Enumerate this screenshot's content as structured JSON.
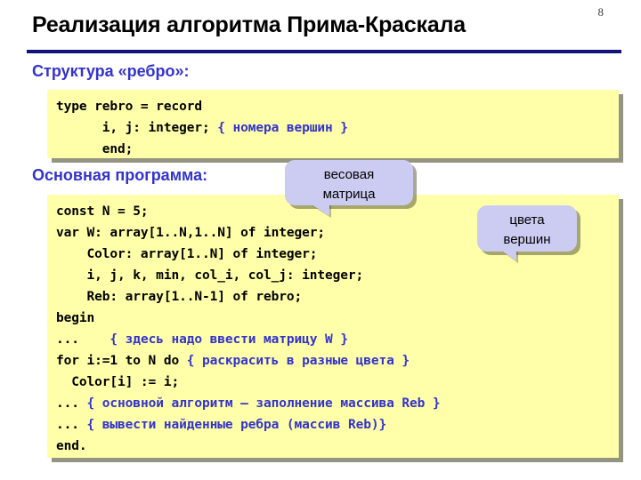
{
  "slide": {
    "number": "8",
    "title": "Реализация алгоритма Прима-Краскала",
    "accent_color": "#12127a",
    "heading_color": "#3333cc",
    "code_background": "#ffffaa",
    "callout_background": "#ccccf2"
  },
  "sections": {
    "structure_heading": "Структура «ребро»:",
    "main_program_heading": "Основная программа:"
  },
  "code_block_1": {
    "lines": [
      [
        {
          "t": "type rebro = record",
          "k": "code"
        }
      ],
      [
        {
          "t": "      i, j: integer; ",
          "k": "code"
        },
        {
          "t": "{ номера вершин }",
          "k": "comment"
        }
      ],
      [
        {
          "t": "      end;",
          "k": "code"
        }
      ]
    ]
  },
  "code_block_2": {
    "lines": [
      [
        {
          "t": "const N = 5;",
          "k": "code"
        }
      ],
      [
        {
          "t": "var W: array[1..N,1..N] of integer;",
          "k": "code"
        }
      ],
      [
        {
          "t": "    Color: array[1..N] of integer;",
          "k": "code"
        }
      ],
      [
        {
          "t": "    i, j, k, min, col_i, col_j: integer;",
          "k": "code"
        }
      ],
      [
        {
          "t": "    Reb: array[1..N-1] of rebro;",
          "k": "code"
        }
      ],
      [
        {
          "t": "begin",
          "k": "code"
        }
      ],
      [
        {
          "t": "...    ",
          "k": "code"
        },
        {
          "t": "{ здесь надо ввести матрицу W }",
          "k": "comment"
        }
      ],
      [
        {
          "t": "for i:=1 to N do ",
          "k": "code"
        },
        {
          "t": "{ раскрасить в разные цвета }",
          "k": "comment"
        }
      ],
      [
        {
          "t": "  Color[i] := i;",
          "k": "code"
        }
      ],
      [
        {
          "t": "... ",
          "k": "code"
        },
        {
          "t": "{ основной алгоритм – заполнение массива Reb }",
          "k": "comment"
        }
      ],
      [
        {
          "t": "... ",
          "k": "code"
        },
        {
          "t": "{ вывести найденные ребра (массив Reb)}",
          "k": "comment"
        }
      ],
      [
        {
          "t": "end.",
          "k": "code"
        }
      ]
    ]
  },
  "callouts": {
    "weight_matrix": [
      "весовая",
      "матрица"
    ],
    "vertex_colors": [
      "цвета",
      "вершин"
    ]
  }
}
